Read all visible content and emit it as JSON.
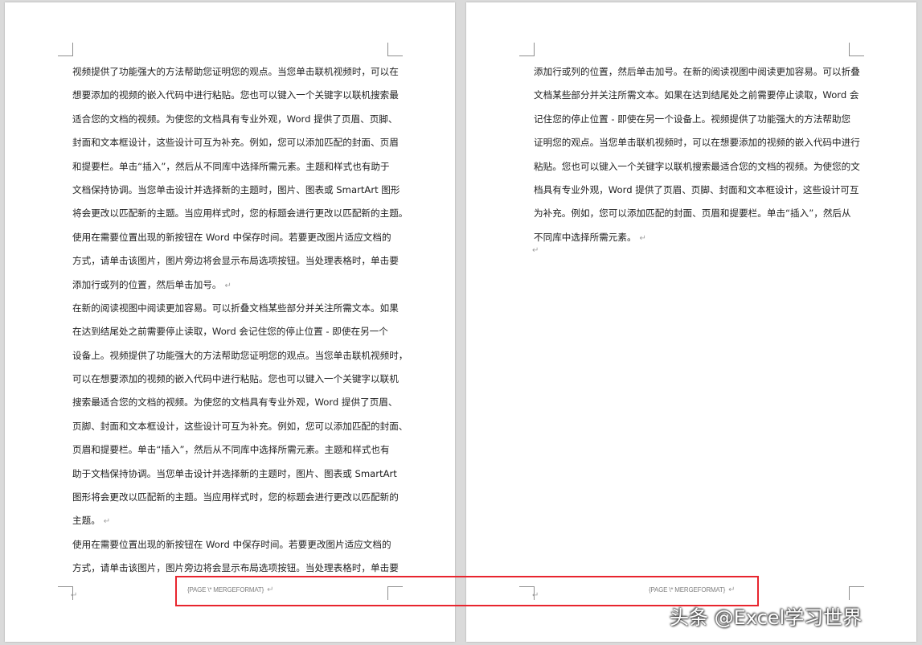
{
  "pages": {
    "left": {
      "lines": [
        "视频提供了功能强大的方法帮助您证明您的观点。当您单击联机视频时，可以在",
        "想要添加的视频的嵌入代码中进行粘贴。您也可以键入一个关键字以联机搜索最",
        "适合您的文档的视频。为使您的文档具有专业外观，Word 提供了页眉、页脚、",
        "封面和文本框设计，这些设计可互为补充。例如，您可以添加匹配的封面、页眉",
        "和提要栏。单击“插入”，然后从不同库中选择所需元素。主题和样式也有助于",
        "文档保持协调。当您单击设计并选择新的主题时，图片、图表或 SmartArt 图形",
        "将会更改以匹配新的主题。当应用样式时，您的标题会进行更改以匹配新的主题。",
        "使用在需要位置出现的新按钮在 Word 中保存时间。若要更改图片适应文档的",
        "方式，请单击该图片，图片旁边将会显示布局选项按钮。当处理表格时，单击要",
        "添加行或列的位置，然后单击加号。",
        "在新的阅读视图中阅读更加容易。可以折叠文档某些部分并关注所需文本。如果",
        "在达到结尾处之前需要停止读取，Word 会记住您的停止位置 - 即使在另一个",
        "设备上。视频提供了功能强大的方法帮助您证明您的观点。当您单击联机视频时，",
        "可以在想要添加的视频的嵌入代码中进行粘贴。您也可以键入一个关键字以联机",
        "搜索最适合您的文档的视频。为使您的文档具有专业外观，Word 提供了页眉、",
        "页脚、封面和文本框设计，这些设计可互为补充。例如，您可以添加匹配的封面、",
        "页眉和提要栏。单击“插入”，然后从不同库中选择所需元素。主题和样式也有",
        "助于文档保持协调。当您单击设计并选择新的主题时，图片、图表或 SmartArt",
        "图形将会更改以匹配新的主题。当应用样式时，您的标题会进行更改以匹配新的",
        "主题。",
        "使用在需要位置出现的新按钮在 Word 中保存时间。若要更改图片适应文档的",
        "方式，请单击该图片，图片旁边将会显示布局选项按钮。当处理表格时，单击要"
      ],
      "footer_field": "{PAGE   \\* MERGEFORMAT}"
    },
    "right": {
      "lines": [
        "添加行或列的位置，然后单击加号。在新的阅读视图中阅读更加容易。可以折叠",
        "文档某些部分并关注所需文本。如果在达到结尾处之前需要停止读取，Word 会",
        "记住您的停止位置 - 即使在另一个设备上。视频提供了功能强大的方法帮助您",
        "证明您的观点。当您单击联机视频时，可以在想要添加的视频的嵌入代码中进行",
        "粘贴。您也可以键入一个关键字以联机搜索最适合您的文档的视频。为使您的文",
        "档具有专业外观，Word 提供了页眉、页脚、封面和文本框设计，这些设计可互",
        "为补充。例如，您可以添加匹配的封面、页眉和提要栏。单击“插入”，然后从",
        "不同库中选择所需元素。"
      ],
      "footer_field": "{PAGE   \\* MERGEFORMAT}"
    }
  },
  "paragraph_mark": "↵",
  "watermark": "头条 @Excel学习世界",
  "colors": {
    "highlight": "#e8252e",
    "page": "#ffffff",
    "canvas": "#dadada"
  }
}
